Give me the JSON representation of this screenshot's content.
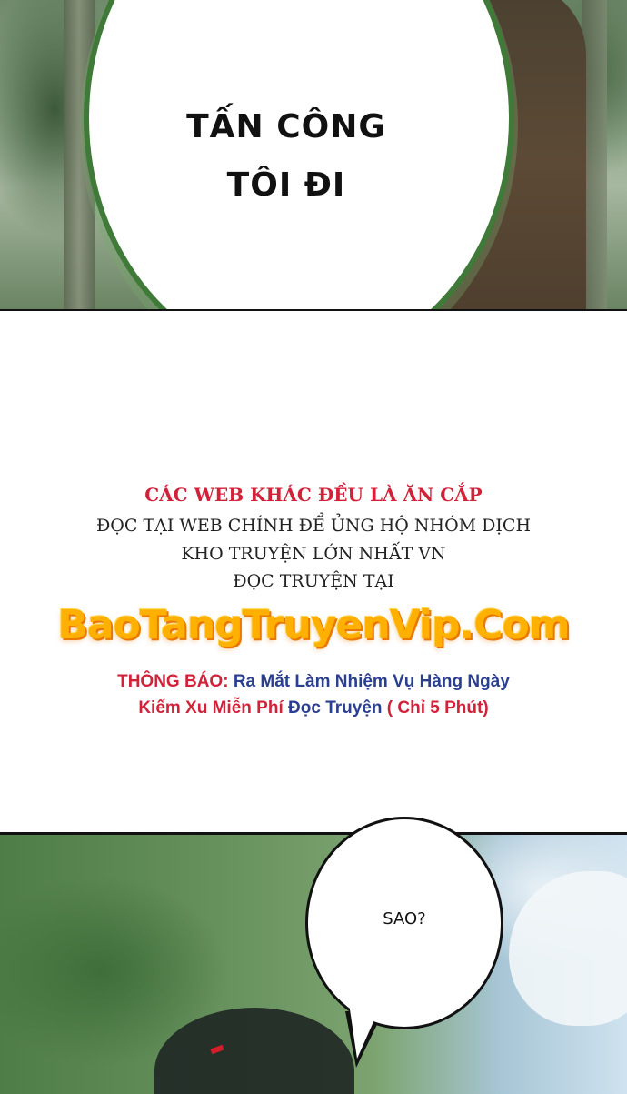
{
  "panel_top": {
    "speech": "TẤN CÔNG\nTÔI ĐI"
  },
  "notice": {
    "warning": "CÁC WEB KHÁC ĐỀU LÀ ĂN CẮP",
    "read_main": "ĐỌC TẠI WEB CHÍNH ĐỂ ỦNG HỘ NHÓM DỊCH",
    "largest": "KHO TRUYỆN LỚN NHẤT VN",
    "read_at": "ĐỌC TRUYỆN TẠI",
    "site": "BaoTangTruyenVip.Com",
    "announce_label": "THÔNG BÁO:",
    "announce_text": "Ra Mắt Làm Nhiệm Vụ Hàng Ngày",
    "announce_line2_red": "Kiếm Xu Miễn Phí",
    "announce_line2_blue": "Đọc Truyện",
    "announce_line2_red_end": "( Chỉ 5 Phút)"
  },
  "panel_bottom": {
    "speech": "SAO?"
  },
  "colors": {
    "speech_border_top": "#3f7a39",
    "warning": "#d2223a",
    "announce_blue": "#2a3f8f",
    "site_orange": "#ffb000"
  }
}
